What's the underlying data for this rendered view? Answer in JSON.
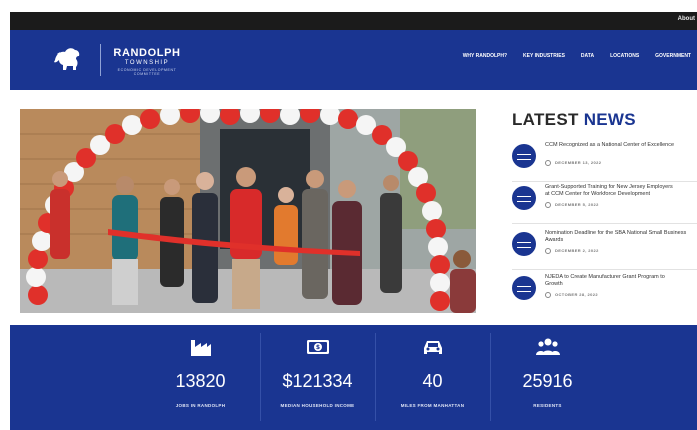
{
  "topbar": {
    "about": "About"
  },
  "header": {
    "brand_name": "RANDOLPH",
    "brand_sub": "TOWNSHIP",
    "brand_tag": "ECONOMIC DEVELOPMENT COMMITTEE",
    "nav": [
      "WHY RANDOLPH?",
      "KEY INDUSTRIES",
      "DATA",
      "LOCATIONS",
      "GOVERNMENT"
    ]
  },
  "news": {
    "title_a": "LATEST",
    "title_b": "NEWS",
    "items": [
      {
        "line1": "CCM Recognized as a National Center of Excellence",
        "line2": "",
        "date": "DECEMBER 13, 2022"
      },
      {
        "line1": "Grant-Supported Training for New Jersey Employers",
        "line2": "at CCM Center for Workforce Development",
        "date": "DECEMBER 5, 2022"
      },
      {
        "line1": "Nomination Deadline for the SBA National Small Business",
        "line2": "Awards",
        "date": "DECEMBER 2, 2022"
      },
      {
        "line1": "NJEDA to Create Manufacturer Grant Program to",
        "line2": "Growth",
        "date": "OCTOBER 28, 2022"
      }
    ]
  },
  "stats": [
    {
      "icon": "factory-icon",
      "value": "13820",
      "label": "JOBS IN RANDOLPH"
    },
    {
      "icon": "money-icon",
      "value": "$121334",
      "label": "MEDIAN HOUSEHOLD INCOME"
    },
    {
      "icon": "car-icon",
      "value": "40",
      "label": "MILES FROM MANHATTAN"
    },
    {
      "icon": "people-icon",
      "value": "25916",
      "label": "RESIDENTS"
    }
  ],
  "colors": {
    "brand_blue": "#1a3591",
    "ribbon_red": "#e0302a",
    "balloon_white": "#f5f5f5"
  }
}
